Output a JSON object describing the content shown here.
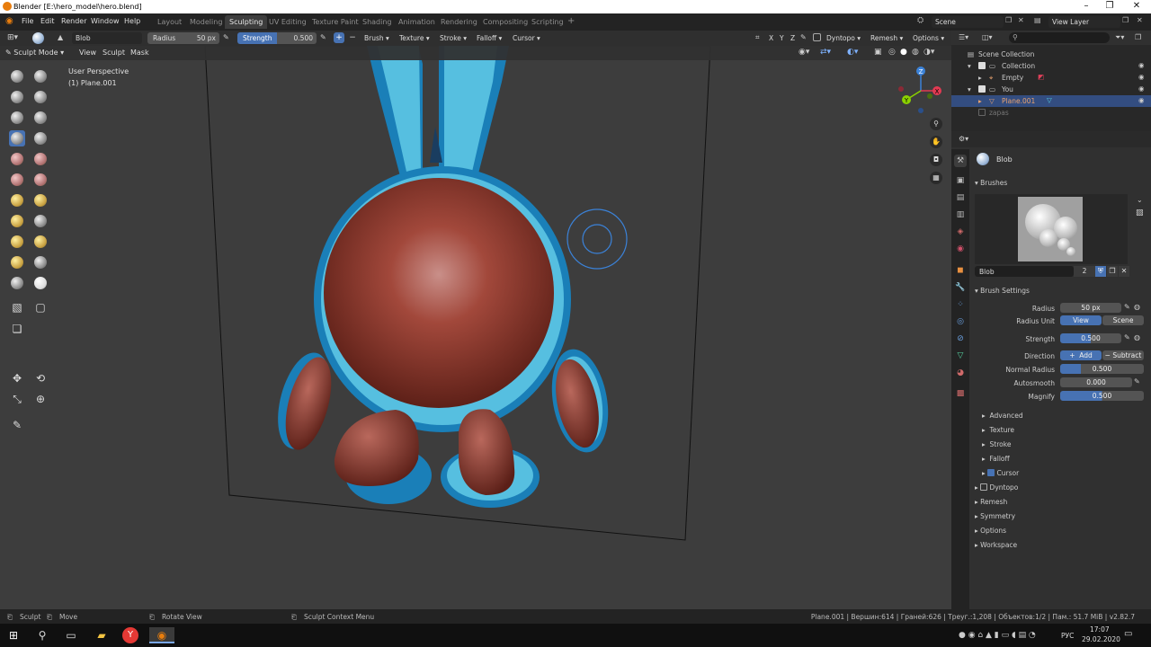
{
  "window": {
    "title": "Blender [E:\\hero_model\\hero.blend]"
  },
  "menu": [
    "File",
    "Edit",
    "Render",
    "Window",
    "Help"
  ],
  "workspaces": [
    "Layout",
    "Modeling",
    "Sculpting",
    "UV Editing",
    "Texture Paint",
    "Shading",
    "Animation",
    "Rendering",
    "Compositing",
    "Scripting",
    "+"
  ],
  "scene": {
    "label": "Scene",
    "view_layer": "View Layer"
  },
  "tool_header": {
    "brush_name": "Blob",
    "radius_label": "Radius",
    "radius_value": "50 px",
    "strength_label": "Strength",
    "strength_value": "0.500",
    "plus": "+",
    "minus": "−",
    "menus": [
      "Brush",
      "Texture",
      "Stroke",
      "Falloff",
      "Cursor"
    ],
    "axes": [
      "X",
      "Y",
      "Z"
    ],
    "dyntopo": "Dyntopo",
    "remesh": "Remesh",
    "options": "Options"
  },
  "viewport_header": {
    "mode": "Sculpt Mode",
    "menus": [
      "View",
      "Sculpt",
      "Mask"
    ]
  },
  "viewport": {
    "perspective": "User Perspective",
    "object": "(1) Plane.001"
  },
  "gizmo": {
    "z": "Z",
    "y": "Y",
    "x": "X"
  },
  "outliner": {
    "search_placeholder": "",
    "rows": [
      {
        "label": "Scene Collection"
      },
      {
        "label": "Collection"
      },
      {
        "label": "Empty"
      },
      {
        "label": "You"
      },
      {
        "label": "Plane.001"
      },
      {
        "label": "zapas"
      }
    ]
  },
  "properties": {
    "brush_title": "Blob",
    "brushes_header": "Brushes",
    "brush_field": "Blob",
    "brush_users": "2",
    "brush_settings_header": "Brush Settings",
    "radius_label": "Radius",
    "radius_value": "50 px",
    "radius_unit_label": "Radius Unit",
    "radius_unit_view": "View",
    "radius_unit_scene": "Scene",
    "strength_label": "Strength",
    "strength_value": "0.500",
    "strength_fill": 0.5,
    "direction_label": "Direction",
    "direction_add": "Add",
    "direction_subtract": "Subtract",
    "normal_radius_label": "Normal Radius",
    "normal_radius_value": "0.500",
    "normal_radius_fill": 0.5,
    "autosmooth_label": "Autosmooth",
    "autosmooth_value": "0.000",
    "magnify_label": "Magnify",
    "magnify_value": "0.500",
    "magnify_fill": 0.5,
    "subsections": [
      "Advanced",
      "Texture",
      "Stroke",
      "Falloff",
      "Cursor"
    ],
    "sections": [
      "Dyntopo",
      "Remesh",
      "Symmetry",
      "Options",
      "Workspace"
    ]
  },
  "status": {
    "sculpt": "Sculpt",
    "move": "Move",
    "rotate": "Rotate View",
    "context": "Sculpt Context Menu",
    "stats": "Plane.001 | Вершин:614 | Граней:626 | Треуг.:1,208 | Объектов:1/2 | Пам.: 51.7 MiB | v2.82.7"
  },
  "taskbar": {
    "lang": "РУС",
    "time": "17:07",
    "date": "29.02.2020"
  },
  "colors": {
    "accent": "#4772b3",
    "body": "#8e3a2c",
    "outline": "#1a7fb8",
    "light_blue": "#56bfe0"
  }
}
